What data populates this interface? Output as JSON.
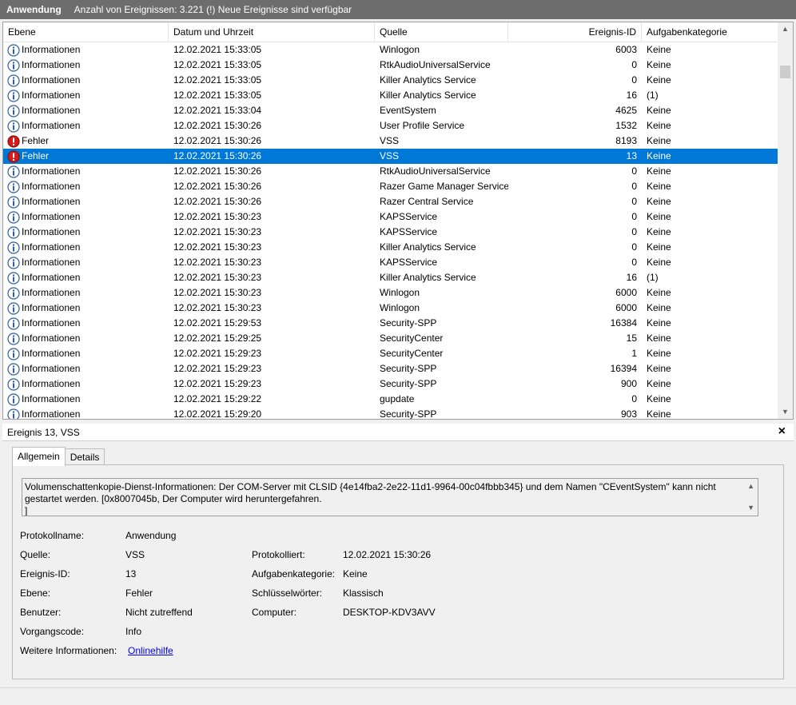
{
  "titlebar": {
    "title": "Anwendung",
    "info": "Anzahl von Ereignissen: 3.221 (!) Neue Ereignisse sind verfügbar"
  },
  "columns": [
    "Ebene",
    "Datum und Uhrzeit",
    "Quelle",
    "Ereignis-ID",
    "Aufgabenkategorie"
  ],
  "rows": [
    {
      "icon": "info-icon",
      "level": "Informationen",
      "date": "12.02.2021 15:33:05",
      "source": "Winlogon",
      "id": "6003",
      "category": "Keine"
    },
    {
      "icon": "info-icon",
      "level": "Informationen",
      "date": "12.02.2021 15:33:05",
      "source": "RtkAudioUniversalService",
      "id": "0",
      "category": "Keine"
    },
    {
      "icon": "info-icon",
      "level": "Informationen",
      "date": "12.02.2021 15:33:05",
      "source": "Killer Analytics Service",
      "id": "0",
      "category": "Keine"
    },
    {
      "icon": "info-icon",
      "level": "Informationen",
      "date": "12.02.2021 15:33:05",
      "source": "Killer Analytics Service",
      "id": "16",
      "category": "(1)"
    },
    {
      "icon": "info-icon",
      "level": "Informationen",
      "date": "12.02.2021 15:33:04",
      "source": "EventSystem",
      "id": "4625",
      "category": "Keine"
    },
    {
      "icon": "info-icon",
      "level": "Informationen",
      "date": "12.02.2021 15:30:26",
      "source": "User Profile Service",
      "id": "1532",
      "category": "Keine"
    },
    {
      "icon": "error-icon",
      "level": "Fehler",
      "date": "12.02.2021 15:30:26",
      "source": "VSS",
      "id": "8193",
      "category": "Keine"
    },
    {
      "icon": "error-icon",
      "level": "Fehler",
      "date": "12.02.2021 15:30:26",
      "source": "VSS",
      "id": "13",
      "category": "Keine",
      "selected": true
    },
    {
      "icon": "info-icon",
      "level": "Informationen",
      "date": "12.02.2021 15:30:26",
      "source": "RtkAudioUniversalService",
      "id": "0",
      "category": "Keine"
    },
    {
      "icon": "info-icon",
      "level": "Informationen",
      "date": "12.02.2021 15:30:26",
      "source": "Razer Game Manager Service",
      "id": "0",
      "category": "Keine"
    },
    {
      "icon": "info-icon",
      "level": "Informationen",
      "date": "12.02.2021 15:30:26",
      "source": "Razer Central Service",
      "id": "0",
      "category": "Keine"
    },
    {
      "icon": "info-icon",
      "level": "Informationen",
      "date": "12.02.2021 15:30:23",
      "source": "KAPSService",
      "id": "0",
      "category": "Keine"
    },
    {
      "icon": "info-icon",
      "level": "Informationen",
      "date": "12.02.2021 15:30:23",
      "source": "KAPSService",
      "id": "0",
      "category": "Keine"
    },
    {
      "icon": "info-icon",
      "level": "Informationen",
      "date": "12.02.2021 15:30:23",
      "source": "Killer Analytics Service",
      "id": "0",
      "category": "Keine"
    },
    {
      "icon": "info-icon",
      "level": "Informationen",
      "date": "12.02.2021 15:30:23",
      "source": "KAPSService",
      "id": "0",
      "category": "Keine"
    },
    {
      "icon": "info-icon",
      "level": "Informationen",
      "date": "12.02.2021 15:30:23",
      "source": "Killer Analytics Service",
      "id": "16",
      "category": "(1)"
    },
    {
      "icon": "info-icon",
      "level": "Informationen",
      "date": "12.02.2021 15:30:23",
      "source": "Winlogon",
      "id": "6000",
      "category": "Keine"
    },
    {
      "icon": "info-icon",
      "level": "Informationen",
      "date": "12.02.2021 15:30:23",
      "source": "Winlogon",
      "id": "6000",
      "category": "Keine"
    },
    {
      "icon": "info-icon",
      "level": "Informationen",
      "date": "12.02.2021 15:29:53",
      "source": "Security-SPP",
      "id": "16384",
      "category": "Keine"
    },
    {
      "icon": "info-icon",
      "level": "Informationen",
      "date": "12.02.2021 15:29:25",
      "source": "SecurityCenter",
      "id": "15",
      "category": "Keine"
    },
    {
      "icon": "info-icon",
      "level": "Informationen",
      "date": "12.02.2021 15:29:23",
      "source": "SecurityCenter",
      "id": "1",
      "category": "Keine"
    },
    {
      "icon": "info-icon",
      "level": "Informationen",
      "date": "12.02.2021 15:29:23",
      "source": "Security-SPP",
      "id": "16394",
      "category": "Keine"
    },
    {
      "icon": "info-icon",
      "level": "Informationen",
      "date": "12.02.2021 15:29:23",
      "source": "Security-SPP",
      "id": "900",
      "category": "Keine"
    },
    {
      "icon": "info-icon",
      "level": "Informationen",
      "date": "12.02.2021 15:29:22",
      "source": "gupdate",
      "id": "0",
      "category": "Keine"
    },
    {
      "icon": "info-icon",
      "level": "Informationen",
      "date": "12.02.2021 15:29:20",
      "source": "Security-SPP",
      "id": "903",
      "category": "Keine"
    }
  ],
  "detail": {
    "header": "Ereignis 13, VSS",
    "close": "×",
    "tabs": [
      "Allgemein",
      "Details"
    ],
    "message_line1": "Volumenschattenkopie-Dienst-Informationen: Der COM-Server mit CLSID {4e14fba2-2e22-11d1-9964-00c04fbbb345} und dem Namen \"CEventSystem\" kann nicht",
    "message_line2": "gestartet werden. [0x8007045b, Der Computer wird heruntergefahren.",
    "message_line3": "]",
    "fields": {
      "log_label": "Protokollname:",
      "log_value": "Anwendung",
      "source_label": "Quelle:",
      "source_value": "VSS",
      "logged_label": "Protokolliert:",
      "logged_value": "12.02.2021 15:30:26",
      "id_label": "Ereignis-ID:",
      "id_value": "13",
      "task_label": "Aufgabenkategorie:",
      "task_value": "Keine",
      "level_label": "Ebene:",
      "level_value": "Fehler",
      "keywords_label": "Schlüsselwörter:",
      "keywords_value": "Klassisch",
      "user_label": "Benutzer:",
      "user_value": "Nicht zutreffend",
      "computer_label": "Computer:",
      "computer_value": "DESKTOP-KDV3AVV",
      "opcode_label": "Vorgangscode:",
      "opcode_value": "Info",
      "more_label": "Weitere Informationen:",
      "more_link": "Onlinehilfe"
    }
  },
  "colors": {
    "selection": "#0078d7",
    "info": "#2e5e9e",
    "error": "#d41c1c"
  }
}
